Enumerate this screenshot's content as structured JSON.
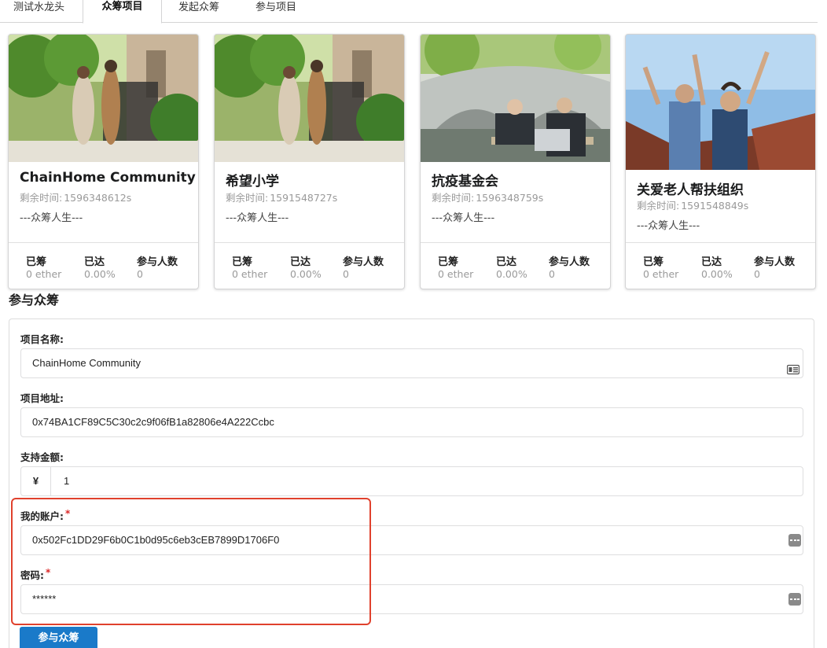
{
  "tabs": [
    {
      "label": "测试水龙头"
    },
    {
      "label": "众筹项目"
    },
    {
      "label": "发起众筹"
    },
    {
      "label": "参与项目"
    }
  ],
  "cards": [
    {
      "title": "ChainHome Community",
      "time_label": "剩余时间:",
      "time_value": "1596348612s",
      "desc": "---众筹人生---",
      "stats": [
        {
          "label": "已筹",
          "value": "0 ether"
        },
        {
          "label": "已达",
          "value": "0.00%"
        },
        {
          "label": "参与人数",
          "value": "0"
        }
      ]
    },
    {
      "title": "希望小学",
      "time_label": "剩余时间:",
      "time_value": "1591548727s",
      "desc": "---众筹人生---",
      "stats": [
        {
          "label": "已筹",
          "value": "0 ether"
        },
        {
          "label": "已达",
          "value": "0.00%"
        },
        {
          "label": "参与人数",
          "value": "0"
        }
      ]
    },
    {
      "title": "抗疫基金会",
      "time_label": "剩余时间:",
      "time_value": "1596348759s",
      "desc": "---众筹人生---",
      "stats": [
        {
          "label": "已筹",
          "value": "0 ether"
        },
        {
          "label": "已达",
          "value": "0.00%"
        },
        {
          "label": "参与人数",
          "value": "0"
        }
      ]
    },
    {
      "title": "关爱老人帮扶组织",
      "time_label": "剩余时间:",
      "time_value": "1591548849s",
      "desc": "---众筹人生---",
      "stats": [
        {
          "label": "已筹",
          "value": "0 ether"
        },
        {
          "label": "已达",
          "value": "0.00%"
        },
        {
          "label": "参与人数",
          "value": "0"
        }
      ]
    }
  ],
  "section": {
    "title": "参与众筹"
  },
  "form": {
    "name_label": "项目名称:",
    "name_value": "ChainHome Community",
    "address_label": "项目地址:",
    "address_value": "0x74BA1CF89C5C30c2c9f06fB1a82806e4A222Ccbc",
    "amount_label": "支持金额:",
    "amount_prefix": "¥",
    "amount_value": "1",
    "account_label": "我的账户:",
    "account_value": "0x502Fc1DD29F6b0C1b0d95c6eb3cEB7899D1706F0",
    "password_label": "密码:",
    "password_value": "******",
    "required_mark": "*",
    "submit_label": "参与众筹"
  },
  "colors": {
    "accent": "#1a7ac9",
    "highlight": "#e0412d",
    "required": "#db2828"
  }
}
